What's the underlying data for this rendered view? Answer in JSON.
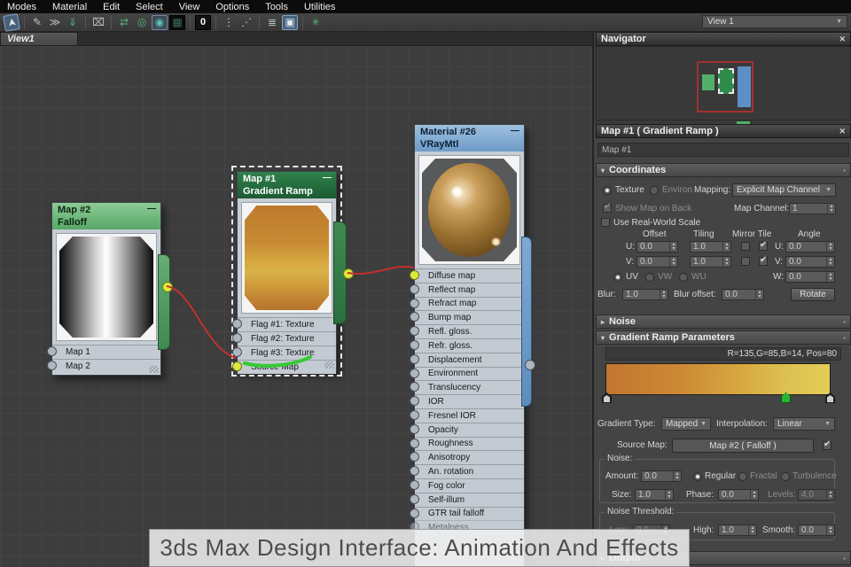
{
  "menu": {
    "items": [
      "Modes",
      "Material",
      "Edit",
      "Select",
      "View",
      "Options",
      "Tools",
      "Utilities"
    ]
  },
  "toolbar": {
    "icons": [
      {
        "name": "select-tool",
        "glyph": "➤"
      },
      {
        "name": "pick-material-from-object",
        "glyph": "✎"
      },
      {
        "name": "put-to-library",
        "glyph": "≫"
      },
      {
        "name": "assign-material-to-selection",
        "glyph": "⇓"
      },
      {
        "name": "delete-selected",
        "glyph": "⌧"
      },
      {
        "name": "move-children",
        "glyph": "⇄"
      },
      {
        "name": "hide-unused-nodeslots",
        "glyph": "◎"
      },
      {
        "name": "show-shaded-material-in-viewport",
        "glyph": "◉"
      },
      {
        "name": "show-background",
        "glyph": "▦"
      },
      {
        "name": "layout-all",
        "glyph": "0"
      },
      {
        "name": "layout-children",
        "glyph": "⋮"
      },
      {
        "name": "arrange-nodes",
        "glyph": "⋰"
      },
      {
        "name": "material-checker",
        "glyph": "≣"
      },
      {
        "name": "material-map-navigator",
        "glyph": "▣"
      },
      {
        "name": "select-by-material",
        "glyph": "✳"
      }
    ],
    "view_selector": "View 1"
  },
  "view": {
    "tab": "View1"
  },
  "navigator": {
    "title": "Navigator"
  },
  "nodes": {
    "falloff": {
      "title": "Map #2",
      "subtitle": "Falloff",
      "slots": [
        "Map 1",
        "Map 2"
      ]
    },
    "gradient": {
      "title": "Map #1",
      "subtitle": "Gradient Ramp",
      "slots": [
        "Flag #1: Texture",
        "Flag #2: Texture",
        "Flag #3: Texture",
        "Source Map"
      ]
    },
    "vray": {
      "title": "Material #26",
      "subtitle": "VRayMtl",
      "slots": [
        "Diffuse map",
        "Reflect map",
        "Refract map",
        "Bump map",
        "Refl. gloss.",
        "Refr. gloss.",
        "Displacement",
        "Environment",
        "Translucency",
        "IOR",
        "Fresnel IOR",
        "Opacity",
        "Roughness",
        "Anisotropy",
        "An. rotation",
        "Fog color",
        "Self-illum",
        "GTR tail falloff",
        "Metalness"
      ]
    }
  },
  "panel": {
    "title": "Map #1  ( Gradient Ramp )",
    "name_value": "Map #1",
    "coordinates": {
      "title": "Coordinates",
      "texture": "Texture",
      "environ": "Environ",
      "mapping_label": "Mapping:",
      "mapping_value": "Explicit Map Channel",
      "show_map_on_back": "Show Map on Back",
      "map_channel_label": "Map Channel:",
      "map_channel": "1",
      "use_real_world_scale": "Use Real-World Scale",
      "col_offset": "Offset",
      "col_tiling": "Tiling",
      "col_mirror_tile": "Mirror Tile",
      "col_angle": "Angle",
      "u_label": "U:",
      "v_label": "V:",
      "w_label": "W:",
      "offset_u": "0.0",
      "offset_v": "0.0",
      "tiling_u": "1.0",
      "tiling_v": "1.0",
      "angle_u": "0.0",
      "angle_v": "0.0",
      "angle_w": "0.0",
      "uv": "UV",
      "vw": "VW",
      "wu": "WU",
      "blur_label": "Blur:",
      "blur": "1.0",
      "blur_offset_label": "Blur offset:",
      "blur_offset": "0.0",
      "rotate": "Rotate"
    },
    "noise_rollout": "Noise",
    "gradient": {
      "title": "Gradient Ramp Parameters",
      "flag_info": "R=135,G=85,B=14, Pos=80",
      "type_label": "Gradient Type:",
      "type_value": "Mapped",
      "interp_label": "Interpolation:",
      "interp_value": "Linear",
      "source_label": "Source Map:",
      "source_value": "Map #2 ( Falloff )",
      "noise_title": "Noise:",
      "amount_label": "Amount:",
      "amount": "0.0",
      "regular": "Regular",
      "fractal": "Fractal",
      "turbulence": "Turbulence",
      "size_label": "Size:",
      "size": "1.0",
      "phase_label": "Phase:",
      "phase": "0.0",
      "levels_label": "Levels:",
      "levels": "4.0",
      "threshold_title": "Noise Threshold:",
      "low_label": "Low:",
      "low": "0.0",
      "high_label": "High:",
      "high": "1.0",
      "smooth_label": "Smooth:",
      "smooth": "0.0"
    },
    "output_rollout": "Output"
  },
  "caption": {
    "text": "3ds Max Design Interface: Animation And Effects"
  },
  "icons": {
    "close": "✕",
    "arrow_down": "▼",
    "roll_open": "▾",
    "roll_closed": "▸",
    "minimize": "—",
    "dots": "▪"
  },
  "colors": {
    "wire": "#c32f2f",
    "selected_flag": "#27b52f",
    "ramp_left": "#c2752f",
    "ramp_right": "#e2cd58",
    "falloff_header": "#72bd83",
    "gradient_header": "#24693d",
    "vray_header": "#86aed6",
    "navigator_view_outline": "#a33030",
    "annotation_green": "#35c935"
  }
}
